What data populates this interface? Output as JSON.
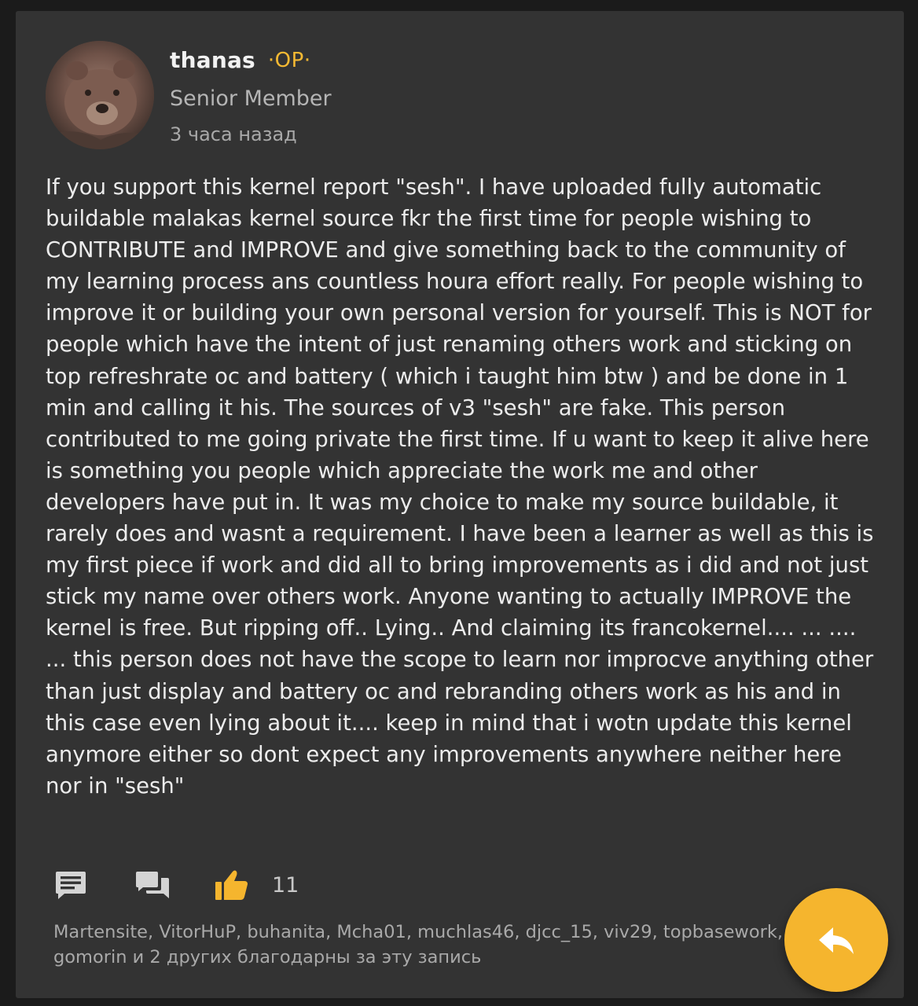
{
  "post": {
    "author": {
      "name": "thanas",
      "badge": "·OP·",
      "rank": "Senior Member",
      "time": "3 часа назад",
      "avatar_icon": "avatar-bear-image"
    },
    "body": "If you support this kernel report \"sesh\". I have uploaded fully automatic buildable malakas kernel source fkr the first time for people wishing to CONTRIBUTE and IMPROVE and give something back to the community of my learning process ans countless houra effort really. For people wishing to improve it or building your own personal version for yourself. This is NOT for people which have the intent of just renaming others work and sticking on top refreshrate oc and battery ( which i taught him btw ) and be done in 1 min and calling it his. The sources of v3 \"sesh\" are fake. This person contributed to me going private the first time. If u want to keep it alive here is something you people which appreciate the work me and other developers have put in. It was my choice to make my source buildable, it rarely does and wasnt a requirement. I have been a learner as well as this is my first piece if work and did all to bring improvements as i did and not just stick my name over others work. Anyone wanting to actually IMPROVE the kernel is free. But ripping off.. Lying.. And claiming its francokernel.... ... .... ... this person does not have the scope to learn nor improcve anything other than just display and battery oc and rebranding others work as his and in this case even lying about it.... keep in mind that i wotn update this kernel anymore either so dont expect any improvements anywhere neither here nor in \"sesh\"",
    "actions": {
      "quote_icon": "quote-icon",
      "multiquote_icon": "multi-quote-icon",
      "like_icon": "thumbs-up-icon",
      "like_count": "11"
    },
    "thanks": {
      "names": "Martensite, VitorHuP, buhanita, Mcha01, muchlas46, djcc_15, viv29, topbasework,",
      "rest": "gomorin и 2 других благодарны за эту запись"
    }
  },
  "fab": {
    "icon": "reply-icon"
  },
  "colors": {
    "page_background": "#1b1b1b",
    "card_background": "#333333",
    "accent": "#f5b52e",
    "text_primary": "#ececec",
    "text_secondary": "#a9a9a9",
    "icon_gray": "#d4d4d4"
  }
}
